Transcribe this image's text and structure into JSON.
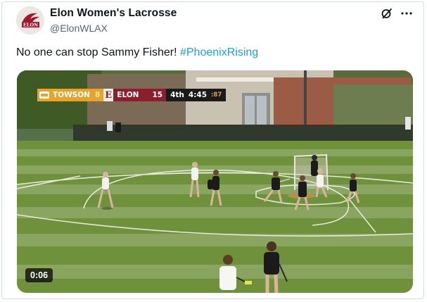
{
  "author": {
    "display_name": "Elon Women's Lacrosse",
    "handle": "@ElonWLAX",
    "avatar_text": "ELON"
  },
  "tweet": {
    "text": "No one can stop Sammy Fisher! ",
    "hashtag": "#PhoenixRising"
  },
  "video": {
    "elapsed": "0:06",
    "scorebug": {
      "team1": "TOWSON",
      "team1_score": "8",
      "team2_logo": "E",
      "team2": "ELON",
      "team2_score": "15",
      "period": "4th",
      "clock": "4:45",
      "shot_clock": ":87"
    }
  },
  "icons": {
    "grok": "grok-icon",
    "more": "more-icon"
  },
  "colors": {
    "hashtag": "#1d9bf0",
    "towson": "#e8a32b",
    "elon": "#8d1f2d",
    "field": "#6f8f3c"
  }
}
